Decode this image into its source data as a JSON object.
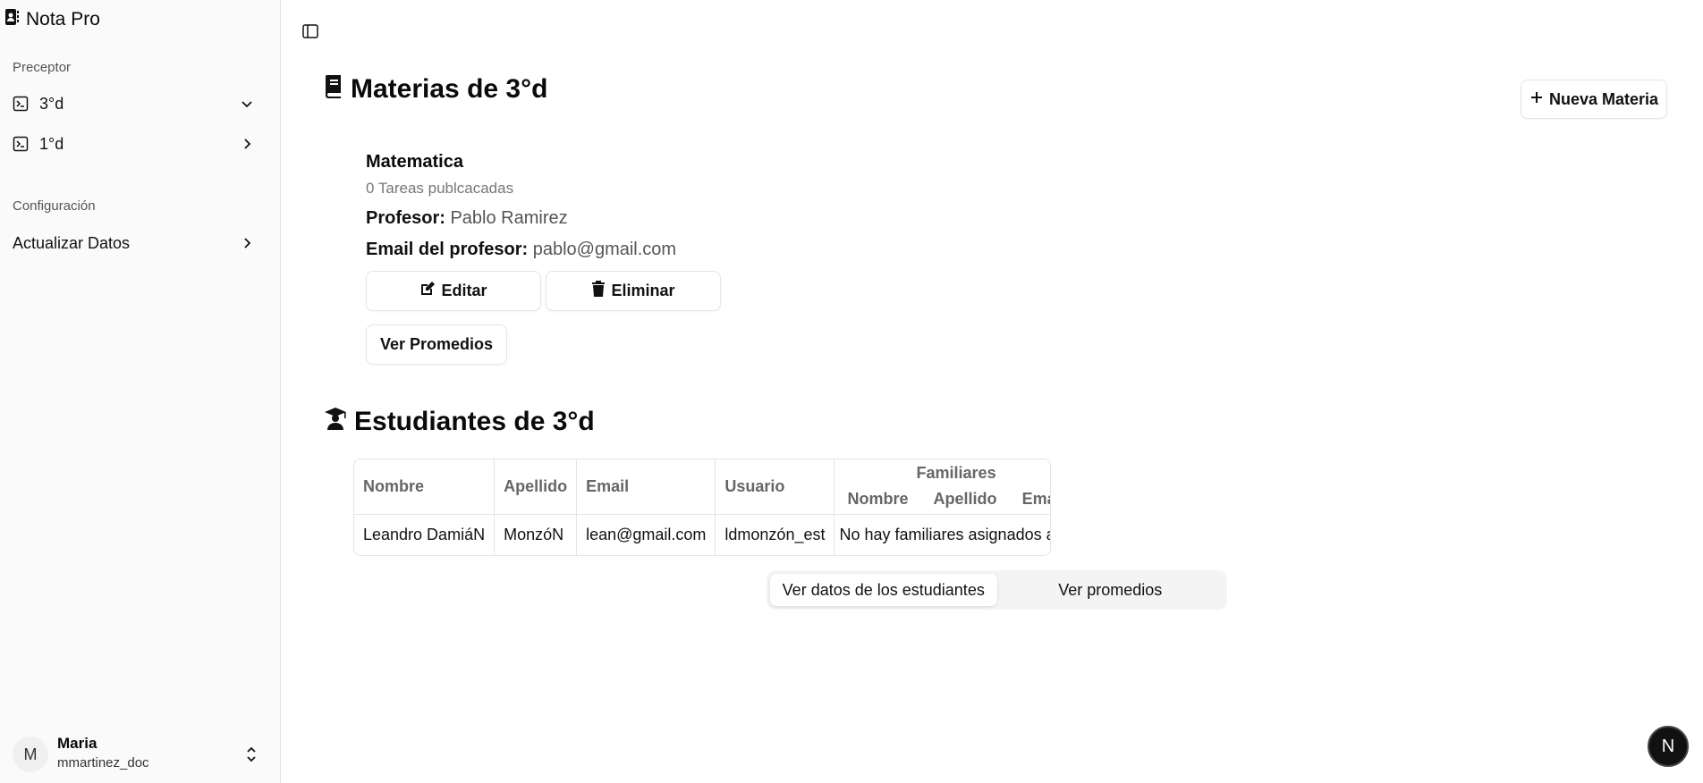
{
  "app": {
    "title": "Nota Pro"
  },
  "sidebar": {
    "group1_label": "Preceptor",
    "courses": [
      {
        "label": "3°d",
        "expanded": true
      },
      {
        "label": "1°d",
        "expanded": false
      }
    ],
    "group2_label": "Configuración",
    "settings_item": "Actualizar Datos"
  },
  "user": {
    "initial": "M",
    "name": "Maria",
    "handle": "mmartinez_doc"
  },
  "main": {
    "title": "Materias de 3°d",
    "new_subject_label": "Nueva Materia",
    "subject": {
      "name": "Matematica",
      "tasks": "0 Tareas publcacadas",
      "teacher_label": "Profesor:",
      "teacher_value": "Pablo Ramirez",
      "email_label": "Email del profesor:",
      "email_value": "pablo@gmail.com",
      "edit_label": "Editar",
      "delete_label": "Eliminar",
      "averages_label": "Ver Promedios"
    },
    "students_title": "Estudiantes de 3°d",
    "table": {
      "headers": {
        "nombre": "Nombre",
        "apellido": "Apellido",
        "email": "Email",
        "usuario": "Usuario",
        "familiares": "Familiares"
      },
      "family_headers": [
        "Nombre",
        "Apellido",
        "Email"
      ],
      "rows": [
        {
          "nombre": "Leandro DamiáN",
          "apellido": "MonzóN",
          "email": "lean@gmail.com",
          "usuario": "ldmonzón_est",
          "familiares": "No hay familiares asignados aún"
        }
      ]
    },
    "tabs": [
      {
        "label": "Ver datos de los estudiantes",
        "active": true
      },
      {
        "label": "Ver promedios",
        "active": false
      }
    ]
  },
  "badge": {
    "letter": "N"
  },
  "colors": {
    "sidebar_bg": "#fafafa",
    "border": "#e5e5e5",
    "accent": "#0a0a0a"
  }
}
